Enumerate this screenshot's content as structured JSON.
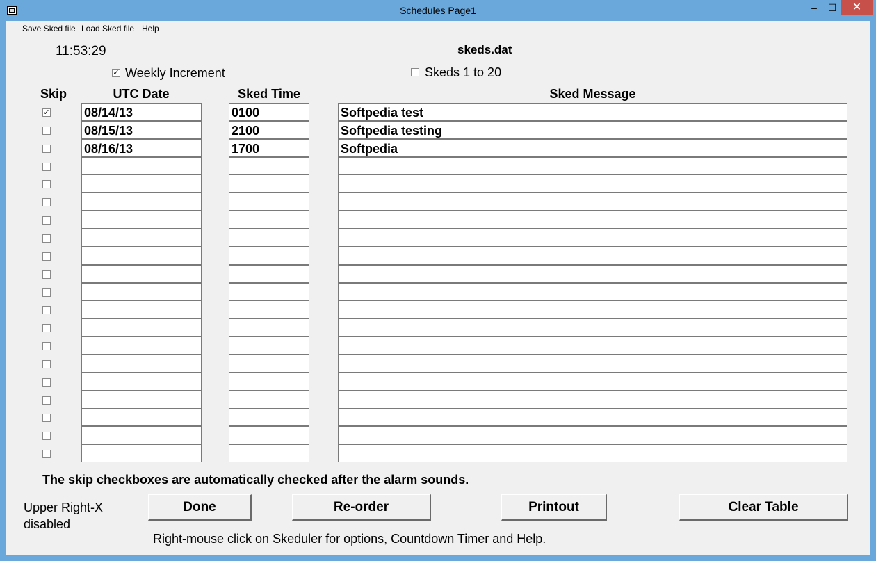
{
  "window": {
    "title": "Schedules Page1",
    "minimize": "–",
    "maximize": "☐",
    "close": "✕"
  },
  "menu": [
    "Save Sked file",
    "Load Sked file",
    "Help"
  ],
  "clock": "11:53:29",
  "filename": "skeds.dat",
  "options": {
    "weekly_increment": {
      "label": "Weekly Increment",
      "checked": true
    },
    "skeds_1_to_20": {
      "label": "Skeds 1 to 20",
      "checked": false
    }
  },
  "columns": {
    "skip": "Skip",
    "date": "UTC Date",
    "time": "Sked Time",
    "message": "Sked Message"
  },
  "rows": [
    {
      "skip": true,
      "date": "08/14/13",
      "time": "0100",
      "message": "Softpedia test"
    },
    {
      "skip": false,
      "date": "08/15/13",
      "time": "2100",
      "message": "Softpedia testing"
    },
    {
      "skip": false,
      "date": "08/16/13",
      "time": "1700",
      "message": "Softpedia"
    },
    {
      "skip": false,
      "date": "",
      "time": "",
      "message": ""
    },
    {
      "skip": false,
      "date": "",
      "time": "",
      "message": ""
    },
    {
      "skip": false,
      "date": "",
      "time": "",
      "message": ""
    },
    {
      "skip": false,
      "date": "",
      "time": "",
      "message": ""
    },
    {
      "skip": false,
      "date": "",
      "time": "",
      "message": ""
    },
    {
      "skip": false,
      "date": "",
      "time": "",
      "message": ""
    },
    {
      "skip": false,
      "date": "",
      "time": "",
      "message": ""
    },
    {
      "skip": false,
      "date": "",
      "time": "",
      "message": ""
    },
    {
      "skip": false,
      "date": "",
      "time": "",
      "message": ""
    },
    {
      "skip": false,
      "date": "",
      "time": "",
      "message": ""
    },
    {
      "skip": false,
      "date": "",
      "time": "",
      "message": ""
    },
    {
      "skip": false,
      "date": "",
      "time": "",
      "message": ""
    },
    {
      "skip": false,
      "date": "",
      "time": "",
      "message": ""
    },
    {
      "skip": false,
      "date": "",
      "time": "",
      "message": ""
    },
    {
      "skip": false,
      "date": "",
      "time": "",
      "message": ""
    },
    {
      "skip": false,
      "date": "",
      "time": "",
      "message": ""
    },
    {
      "skip": false,
      "date": "",
      "time": "",
      "message": ""
    }
  ],
  "note": "The skip checkboxes are automatically checked after the alarm sounds.",
  "upper_right_note": [
    "Upper Right-X",
    "disabled"
  ],
  "buttons": {
    "done": "Done",
    "reorder": "Re-order",
    "printout": "Printout",
    "clear": "Clear Table"
  },
  "hint": "Right-mouse click on Skeduler for options, Countdown Timer and Help.",
  "colors": {
    "title_bar": "#6aa8dc",
    "close_button": "#c7504b",
    "client_bg": "#f0f0f0"
  }
}
